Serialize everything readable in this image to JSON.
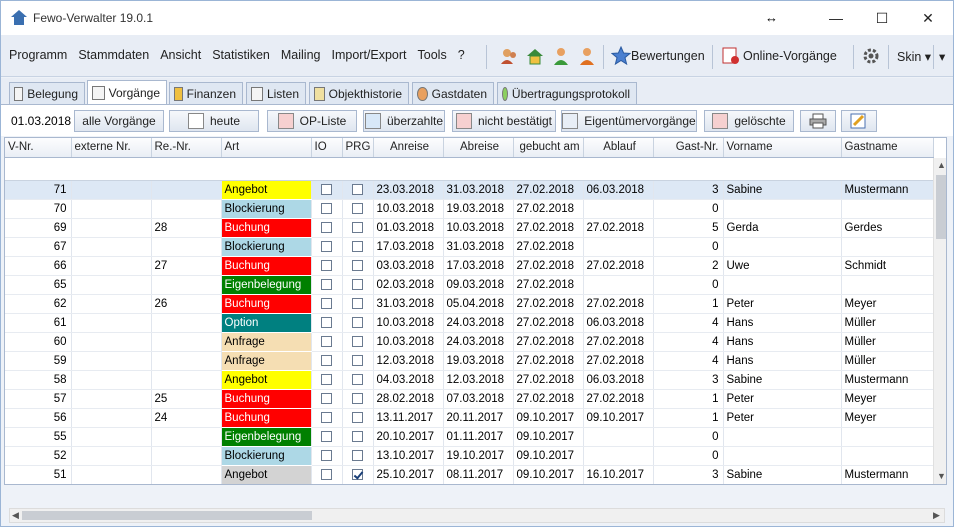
{
  "app": {
    "title": "Fewo-Verwalter 19.0.1"
  },
  "window_controls": {
    "resize": "↔",
    "minimize": "—",
    "maximize": "☐",
    "close": "✕"
  },
  "menu": [
    "Programm",
    "Stammdaten",
    "Ansicht",
    "Statistiken",
    "Mailing",
    "Import/Export",
    "Tools",
    "?"
  ],
  "toolbar": {
    "bewertungen": "Bewertungen",
    "online": "Online-Vorgänge",
    "skin": "Skin ▾",
    "overflow": "▾"
  },
  "tabs": [
    "Belegung",
    "Vorgänge",
    "Finanzen",
    "Listen",
    "Objekthistorie",
    "Gastdaten",
    "Übertragungsprotokoll"
  ],
  "active_tab": "Vorgänge",
  "filter": {
    "date": "01.03.2018",
    "buttons": [
      "alle Vorgänge",
      "heute",
      "OP-Liste",
      "überzahlte",
      "nicht bestätigt",
      "Eigentümervorgänge",
      "gelöschte"
    ]
  },
  "colors": {
    "Angebot": "#ffff00",
    "Blockierung": "#add8e6",
    "Buchung": "#ff0000",
    "Eigenbelegung": "#008000",
    "Option": "#008080",
    "Anfrage": "#f5deb3",
    "Angebot_grey": "#d3d3d3"
  },
  "columns": [
    "V-Nr.",
    "externe Nr.",
    "Re.-Nr.",
    "Art",
    "IO",
    "PRG",
    "Anreise",
    "Abreise",
    "gebucht am",
    "Ablauf",
    "Gast-Nr.",
    "Vorname",
    "Gastname"
  ],
  "rows": [
    {
      "vnr": "71",
      "ext": "",
      "re": "",
      "art": "Angebot",
      "color": "#ffff00",
      "io": false,
      "prg": false,
      "an": "23.03.2018",
      "ab": "31.03.2018",
      "geb": "27.02.2018",
      "abl": "06.03.2018",
      "gast": "3",
      "vor": "Sabine",
      "name": "Mustermann"
    },
    {
      "vnr": "70",
      "ext": "",
      "re": "",
      "art": "Blockierung",
      "color": "#add8e6",
      "io": false,
      "prg": false,
      "an": "10.03.2018",
      "ab": "19.03.2018",
      "geb": "27.02.2018",
      "abl": "",
      "gast": "0",
      "vor": "",
      "name": ""
    },
    {
      "vnr": "69",
      "ext": "",
      "re": "28",
      "art": "Buchung",
      "color": "#ff0000",
      "io": false,
      "prg": false,
      "an": "01.03.2018",
      "ab": "10.03.2018",
      "geb": "27.02.2018",
      "abl": "27.02.2018",
      "gast": "5",
      "vor": "Gerda",
      "name": "Gerdes"
    },
    {
      "vnr": "67",
      "ext": "",
      "re": "",
      "art": "Blockierung",
      "color": "#add8e6",
      "io": false,
      "prg": false,
      "an": "17.03.2018",
      "ab": "31.03.2018",
      "geb": "27.02.2018",
      "abl": "",
      "gast": "0",
      "vor": "",
      "name": ""
    },
    {
      "vnr": "66",
      "ext": "",
      "re": "27",
      "art": "Buchung",
      "color": "#ff0000",
      "io": false,
      "prg": false,
      "an": "03.03.2018",
      "ab": "17.03.2018",
      "geb": "27.02.2018",
      "abl": "27.02.2018",
      "gast": "2",
      "vor": "Uwe",
      "name": "Schmidt"
    },
    {
      "vnr": "65",
      "ext": "",
      "re": "",
      "art": "Eigenbelegung",
      "color": "#008000",
      "io": false,
      "prg": false,
      "an": "02.03.2018",
      "ab": "09.03.2018",
      "geb": "27.02.2018",
      "abl": "",
      "gast": "0",
      "vor": "",
      "name": ""
    },
    {
      "vnr": "62",
      "ext": "",
      "re": "26",
      "art": "Buchung",
      "color": "#ff0000",
      "io": false,
      "prg": false,
      "an": "31.03.2018",
      "ab": "05.04.2018",
      "geb": "27.02.2018",
      "abl": "27.02.2018",
      "gast": "1",
      "vor": "Peter",
      "name": "Meyer"
    },
    {
      "vnr": "61",
      "ext": "",
      "re": "",
      "art": "Option",
      "color": "#008080",
      "io": false,
      "prg": false,
      "an": "10.03.2018",
      "ab": "24.03.2018",
      "geb": "27.02.2018",
      "abl": "06.03.2018",
      "gast": "4",
      "vor": "Hans",
      "name": "Müller"
    },
    {
      "vnr": "60",
      "ext": "",
      "re": "",
      "art": "Anfrage",
      "color": "#f5deb3",
      "io": false,
      "prg": false,
      "an": "10.03.2018",
      "ab": "24.03.2018",
      "geb": "27.02.2018",
      "abl": "27.02.2018",
      "gast": "4",
      "vor": "Hans",
      "name": "Müller"
    },
    {
      "vnr": "59",
      "ext": "",
      "re": "",
      "art": "Anfrage",
      "color": "#f5deb3",
      "io": false,
      "prg": false,
      "an": "12.03.2018",
      "ab": "19.03.2018",
      "geb": "27.02.2018",
      "abl": "27.02.2018",
      "gast": "4",
      "vor": "Hans",
      "name": "Müller"
    },
    {
      "vnr": "58",
      "ext": "",
      "re": "",
      "art": "Angebot",
      "color": "#ffff00",
      "io": false,
      "prg": false,
      "an": "04.03.2018",
      "ab": "12.03.2018",
      "geb": "27.02.2018",
      "abl": "06.03.2018",
      "gast": "3",
      "vor": "Sabine",
      "name": "Mustermann"
    },
    {
      "vnr": "57",
      "ext": "",
      "re": "25",
      "art": "Buchung",
      "color": "#ff0000",
      "io": false,
      "prg": false,
      "an": "28.02.2018",
      "ab": "07.03.2018",
      "geb": "27.02.2018",
      "abl": "27.02.2018",
      "gast": "1",
      "vor": "Peter",
      "name": "Meyer"
    },
    {
      "vnr": "56",
      "ext": "",
      "re": "24",
      "art": "Buchung",
      "color": "#ff0000",
      "io": false,
      "prg": false,
      "an": "13.11.2017",
      "ab": "20.11.2017",
      "geb": "09.10.2017",
      "abl": "09.10.2017",
      "gast": "1",
      "vor": "Peter",
      "name": "Meyer"
    },
    {
      "vnr": "55",
      "ext": "",
      "re": "",
      "art": "Eigenbelegung",
      "color": "#008000",
      "io": false,
      "prg": false,
      "an": "20.10.2017",
      "ab": "01.11.2017",
      "geb": "09.10.2017",
      "abl": "",
      "gast": "0",
      "vor": "",
      "name": ""
    },
    {
      "vnr": "52",
      "ext": "",
      "re": "",
      "art": "Blockierung",
      "color": "#add8e6",
      "io": false,
      "prg": false,
      "an": "13.10.2017",
      "ab": "19.10.2017",
      "geb": "09.10.2017",
      "abl": "",
      "gast": "0",
      "vor": "",
      "name": ""
    },
    {
      "vnr": "51",
      "ext": "",
      "re": "",
      "art": "Angebot",
      "color": "#d3d3d3",
      "io": false,
      "prg": true,
      "an": "25.10.2017",
      "ab": "08.11.2017",
      "geb": "09.10.2017",
      "abl": "16.10.2017",
      "gast": "3",
      "vor": "Sabine",
      "name": "Mustermann"
    }
  ]
}
